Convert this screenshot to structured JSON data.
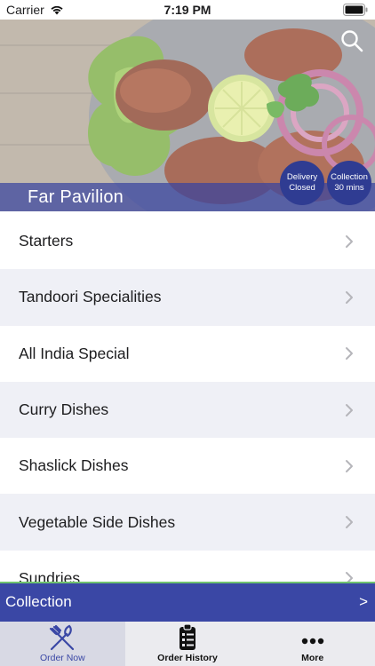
{
  "status_bar": {
    "carrier": "Carrier",
    "time": "7:19 PM"
  },
  "restaurant": {
    "name": "Far Pavilion"
  },
  "badges": {
    "delivery_line1": "Delivery",
    "delivery_line2": "Closed",
    "collection_line1": "Collection",
    "collection_line2": "30 mins"
  },
  "menu": {
    "items": [
      {
        "label": "Starters"
      },
      {
        "label": "Tandoori Specialities"
      },
      {
        "label": "All India Special"
      },
      {
        "label": "Curry Dishes"
      },
      {
        "label": "Shaslick Dishes"
      },
      {
        "label": "Vegetable Side Dishes"
      },
      {
        "label": "Sundries"
      }
    ]
  },
  "collection_bar": {
    "label": "Collection",
    "arrow": ">"
  },
  "tabs": [
    {
      "label": "Order Now",
      "icon": "fork-knife-icon",
      "active": true
    },
    {
      "label": "Order History",
      "icon": "clipboard-list-icon",
      "active": false
    },
    {
      "label": "More",
      "icon": "more-dots-icon",
      "active": false
    }
  ],
  "colors": {
    "brand_blue": "#3a47a5",
    "badge_blue": "#2f3c92",
    "accent_green": "#6fc36f"
  }
}
